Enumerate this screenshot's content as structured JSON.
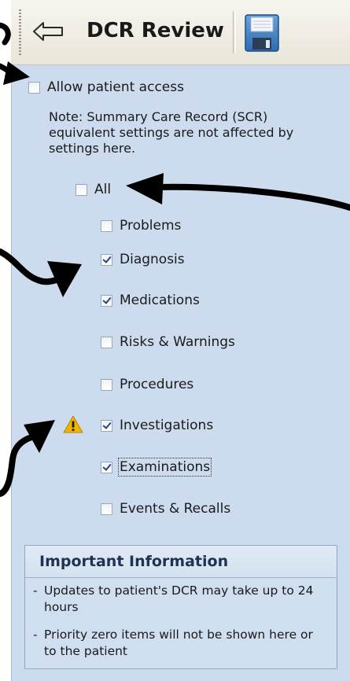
{
  "toolbar": {
    "title": "DCR Review",
    "back_icon": "back-arrow-icon",
    "save_icon": "floppy-disk-icon"
  },
  "access": {
    "allow_label": "Allow patient access",
    "allow_checked": false,
    "note": "Note: Summary Care Record (SCR) equivalent settings are not affected by settings here."
  },
  "categories": {
    "all": {
      "label": "All",
      "checked": false
    },
    "items": [
      {
        "label": "Problems",
        "checked": false
      },
      {
        "label": "Diagnosis",
        "checked": true
      },
      {
        "label": "Medications",
        "checked": true
      },
      {
        "label": "Risks & Warnings",
        "checked": false
      },
      {
        "label": "Procedures",
        "checked": false
      },
      {
        "label": "Investigations",
        "checked": true,
        "warning": true
      },
      {
        "label": "Examinations",
        "checked": true,
        "focused": true
      },
      {
        "label": "Events & Recalls",
        "checked": false
      }
    ]
  },
  "info": {
    "title": "Important Information",
    "items": [
      "Updates to patient's DCR may take up to 24 hours",
      "Priority zero items will not be shown here or to the patient"
    ]
  },
  "colors": {
    "panel_bg": "#ccdcee",
    "check_mark": "#2b3e8c",
    "warning": "#f0b400"
  }
}
